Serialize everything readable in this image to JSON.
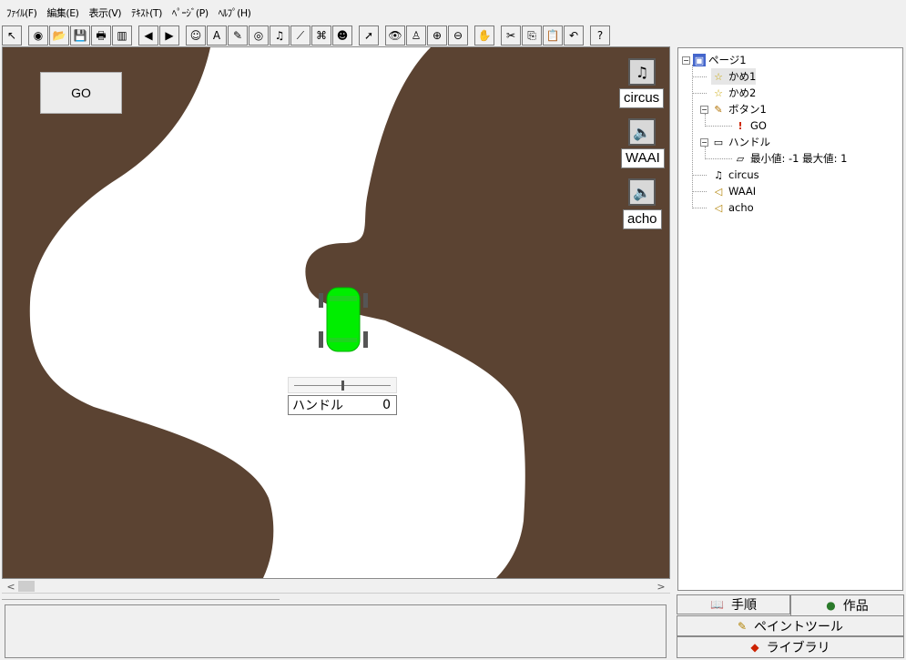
{
  "menu": [
    "ﾌｧｲﾙ(F)",
    "編集(E)",
    "表示(V)",
    "ﾃｷｽﾄ(T)",
    "ﾍﾟｰｼﾞ(P)",
    "ﾍﾙﾌﾟ(H)"
  ],
  "toolbar": {
    "icons": [
      "pointer-select-icon",
      "new-page-icon",
      "open-folder-icon",
      "save-icon",
      "print-icon",
      "layout-icon",
      "prev-page-icon",
      "next-page-icon",
      "character-icon",
      "text-tool-icon",
      "pen-tool-icon",
      "eye-part-icon",
      "music-icon",
      "wand-icon",
      "binoculars-icon",
      "robot-icon",
      "arrow-cursor-icon",
      "view-icon",
      "stamp-icon",
      "zoom-in-icon",
      "zoom-out-icon",
      "stop-icon",
      "cut-icon",
      "copy-icon",
      "paste-icon",
      "undo-icon",
      "help-icon"
    ],
    "glyphs": [
      "↖",
      "◉",
      "📂",
      "💾",
      "🖶",
      "▥",
      "◀",
      "▶",
      "☺",
      "A",
      "✎",
      "◎",
      "♫",
      "⟋",
      "⌘",
      "☻",
      "➚",
      "👁",
      "♙",
      "⊕",
      "⊖",
      "✋",
      "✂",
      "⎘",
      "📋",
      "↶",
      "?"
    ]
  },
  "stage": {
    "go_button": "GO",
    "sounds": [
      {
        "label": "circus",
        "icon": "music-note-icon",
        "glyph": "♫"
      },
      {
        "label": "WAAI",
        "icon": "speaker-icon",
        "glyph": "🔈"
      },
      {
        "label": "acho",
        "icon": "speaker-icon",
        "glyph": "🔈"
      }
    ],
    "slider": {
      "label": "ハンドル",
      "value": "0",
      "level": 0.5
    },
    "colors": {
      "road": "#ffffff",
      "ground": "#5b4332",
      "car": "#00ee00"
    }
  },
  "tree": {
    "root": "ページ1",
    "items": [
      {
        "label": "かめ1",
        "icon": "turtle-icon",
        "glyph": "☆"
      },
      {
        "label": "かめ2",
        "icon": "turtle-icon",
        "glyph": "☆"
      },
      {
        "label": "ボタン1",
        "icon": "button-icon",
        "glyph": "✎"
      },
      {
        "label": "GO",
        "icon": "rocket-icon",
        "glyph": "!"
      },
      {
        "label": "ハンドル",
        "icon": "slider-icon",
        "glyph": "▭"
      },
      {
        "label": "最小値: -1  最大値: 1",
        "icon": "range-icon",
        "glyph": "▱"
      },
      {
        "label": "circus",
        "icon": "music-note-icon",
        "glyph": "♫"
      },
      {
        "label": "WAAI",
        "icon": "speaker-icon",
        "glyph": "◁"
      },
      {
        "label": "acho",
        "icon": "speaker-icon",
        "glyph": "◁"
      }
    ]
  },
  "tabs": {
    "procedure": "手順",
    "work": "作品",
    "paint": "ペイントツール",
    "library": "ライブラリ"
  },
  "scroll": {
    "left": "<",
    "right": ">"
  }
}
